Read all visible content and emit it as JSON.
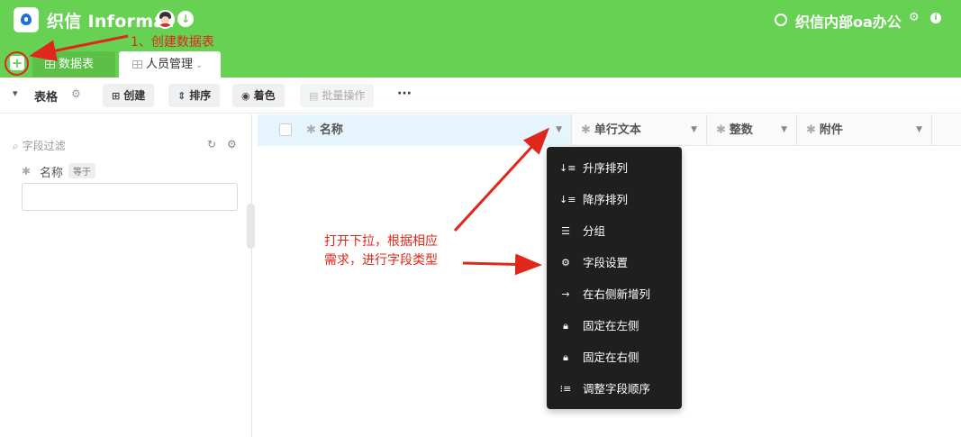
{
  "header": {
    "app_title": "织信 Informat",
    "workspace_name": "织信内部oa办公",
    "brand_color": "#66d153"
  },
  "tabs": [
    {
      "label": "数据表"
    },
    {
      "label": "人员管理"
    }
  ],
  "toolbar": {
    "view_label": "表格",
    "create_label": "创建",
    "sort_label": "排序",
    "color_label": "着色",
    "batch_label": "批量操作",
    "more_label": "···"
  },
  "sidebar": {
    "filter_title": "字段过滤",
    "field_name": "名称",
    "operator": "等于",
    "value": ""
  },
  "grid": {
    "columns": [
      {
        "label": "名称"
      },
      {
        "label": "单行文本"
      },
      {
        "label": "整数"
      },
      {
        "label": "附件"
      }
    ]
  },
  "column_menu": {
    "items": [
      {
        "label": "升序排列",
        "icon": "sort-ascending-icon"
      },
      {
        "label": "降序排列",
        "icon": "sort-descending-icon"
      },
      {
        "label": "分组",
        "icon": "group-list-icon"
      },
      {
        "label": "字段设置",
        "icon": "gear-icon"
      },
      {
        "label": "在右侧新增列",
        "icon": "arrow-right-icon"
      },
      {
        "label": "固定在左侧",
        "icon": "lock-icon"
      },
      {
        "label": "固定在右侧",
        "icon": "lock-icon"
      },
      {
        "label": "调整字段顺序",
        "icon": "reorder-list-icon"
      }
    ]
  },
  "annotations": {
    "step1": "1、创建数据表",
    "step2_line1": "打开下拉，根据相应",
    "step2_line2": "需求，进行字段类型",
    "color": "#e0271b"
  }
}
